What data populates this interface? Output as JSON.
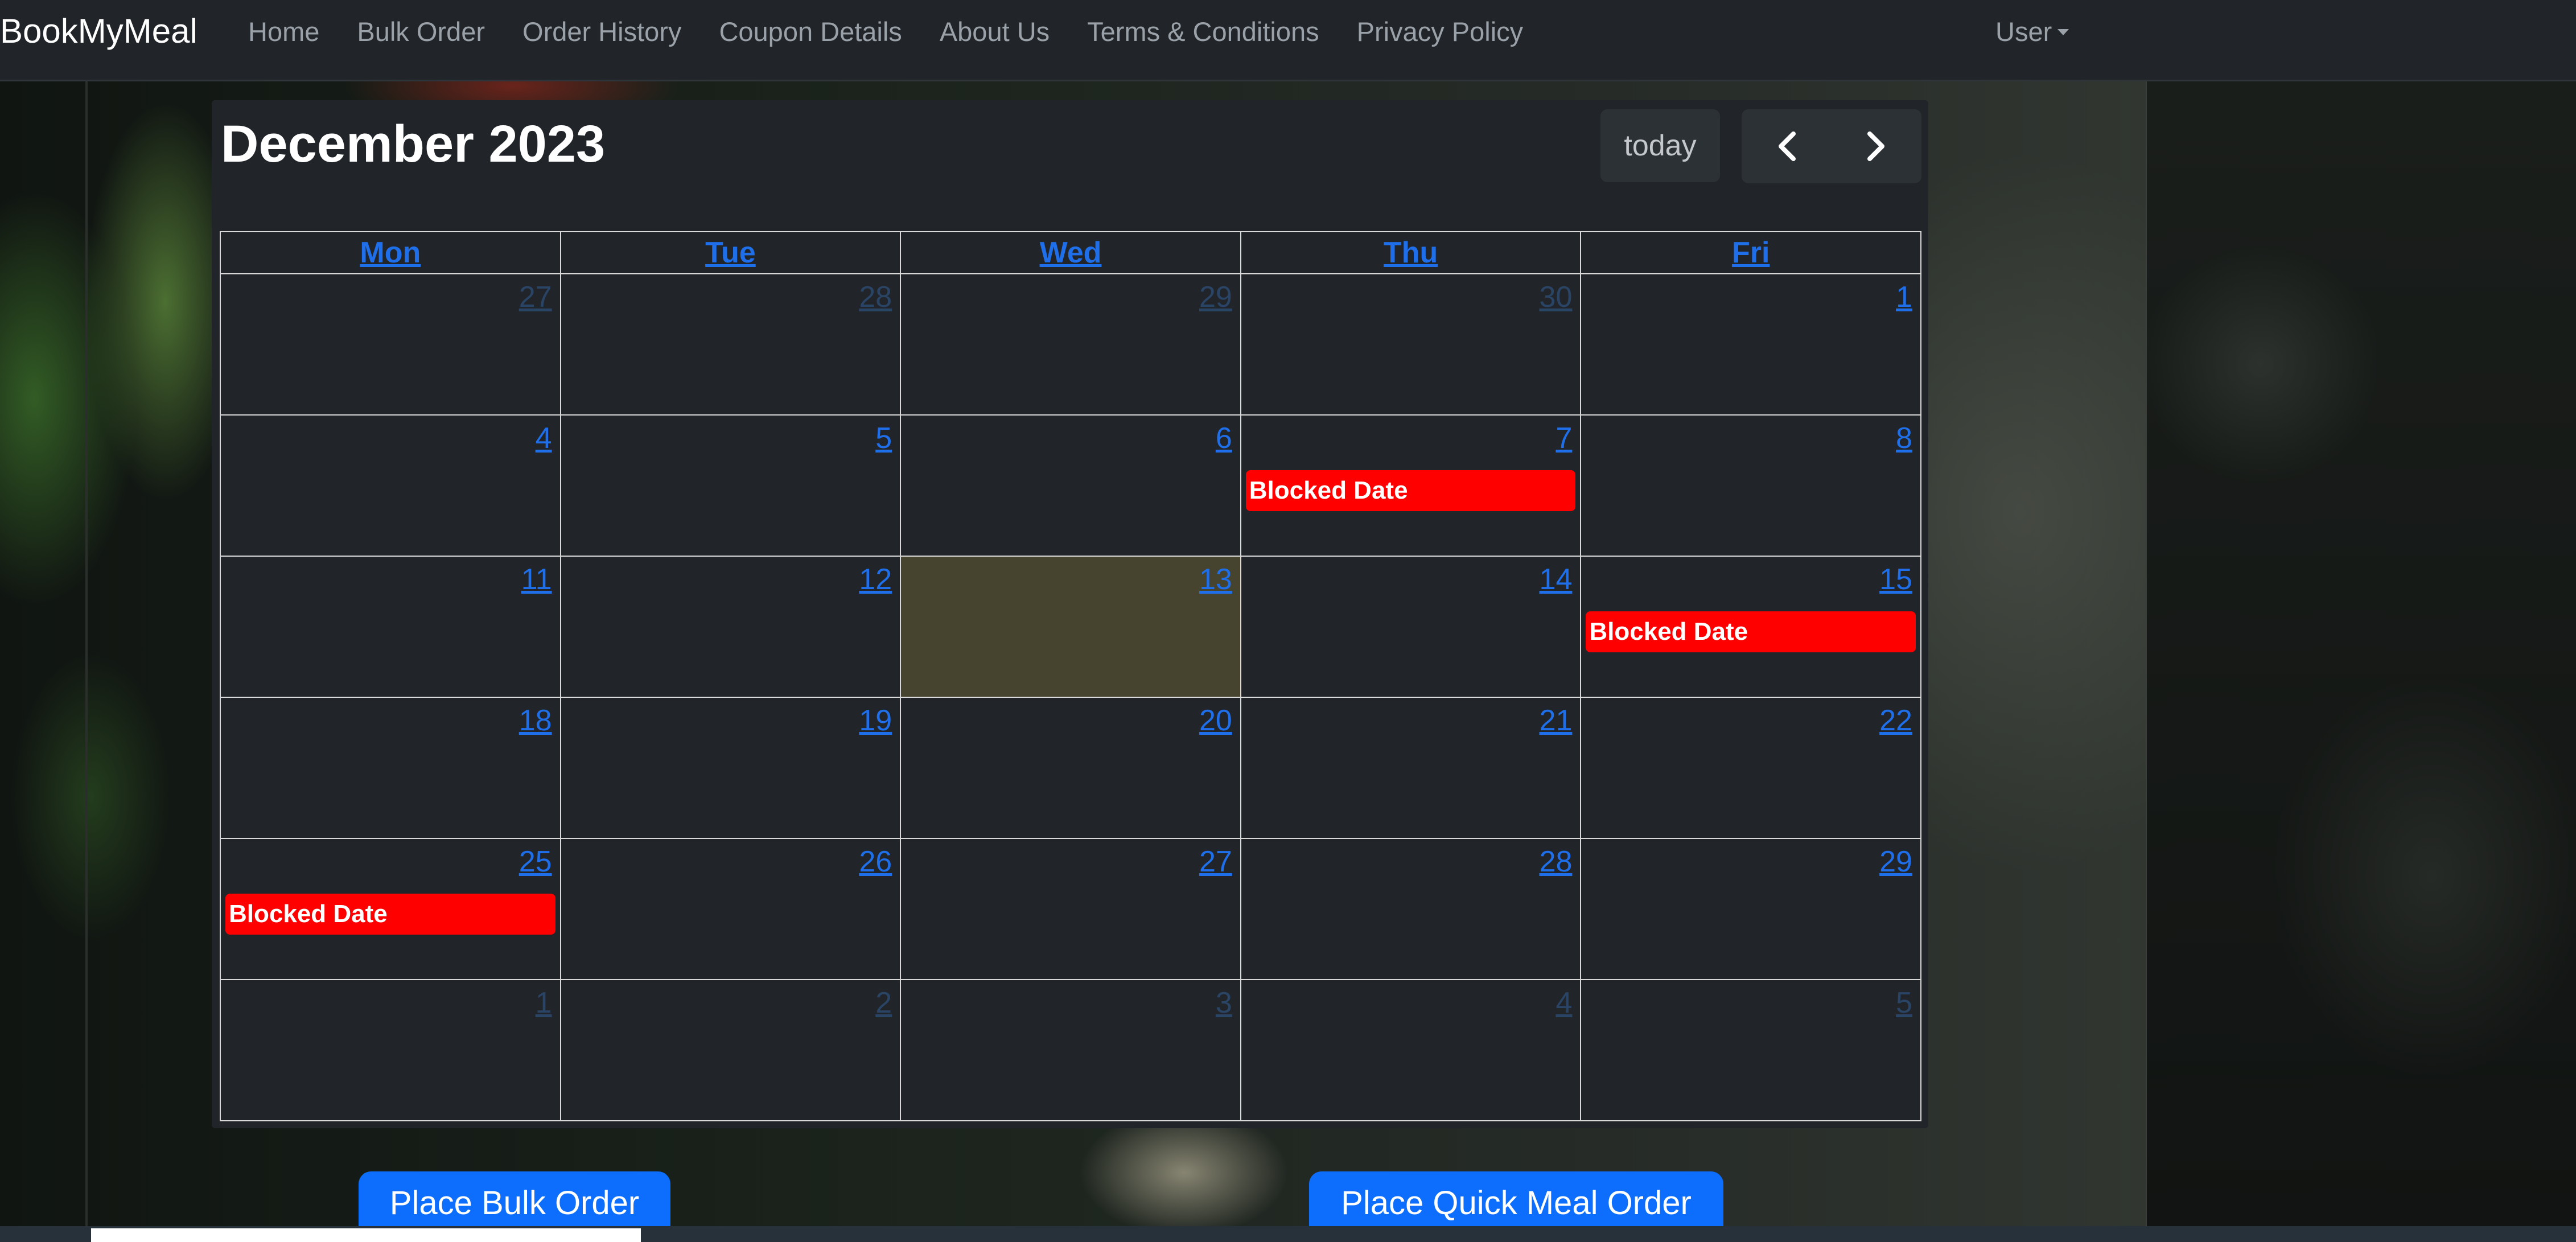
{
  "navbar": {
    "brand": "BookMyMeal",
    "links": [
      "Home",
      "Bulk Order",
      "Order History",
      "Coupon Details",
      "About Us",
      "Terms & Conditions",
      "Privacy Policy"
    ],
    "user_label": "User"
  },
  "calendar": {
    "title": "December 2023",
    "today_label": "today",
    "weekdays": [
      "Mon",
      "Tue",
      "Wed",
      "Thu",
      "Fri"
    ],
    "weeks": [
      [
        {
          "day": "27",
          "other": true
        },
        {
          "day": "28",
          "other": true
        },
        {
          "day": "29",
          "other": true
        },
        {
          "day": "30",
          "other": true
        },
        {
          "day": "1"
        }
      ],
      [
        {
          "day": "4"
        },
        {
          "day": "5"
        },
        {
          "day": "6"
        },
        {
          "day": "7",
          "event": "Blocked Date"
        },
        {
          "day": "8"
        }
      ],
      [
        {
          "day": "11"
        },
        {
          "day": "12"
        },
        {
          "day": "13",
          "today": true
        },
        {
          "day": "14"
        },
        {
          "day": "15",
          "event": "Blocked Date"
        }
      ],
      [
        {
          "day": "18"
        },
        {
          "day": "19"
        },
        {
          "day": "20"
        },
        {
          "day": "21"
        },
        {
          "day": "22"
        }
      ],
      [
        {
          "day": "25",
          "event": "Blocked Date"
        },
        {
          "day": "26"
        },
        {
          "day": "27"
        },
        {
          "day": "28"
        },
        {
          "day": "29"
        }
      ],
      [
        {
          "day": "1",
          "other": true
        },
        {
          "day": "2",
          "other": true
        },
        {
          "day": "3",
          "other": true
        },
        {
          "day": "4",
          "other": true
        },
        {
          "day": "5",
          "other": true
        }
      ]
    ]
  },
  "actions": {
    "bulk_order_label": "Place Bulk Order",
    "quick_order_label": "Place Quick Meal Order"
  },
  "icons": {
    "prev": "chevron-left-icon",
    "next": "chevron-right-icon",
    "user_caret": "caret-down-icon"
  },
  "colors": {
    "navbar_bg": "#212529",
    "calendar_bg": "#212529",
    "link_blue": "#1f6feb",
    "blocked_event": "#ff0000",
    "today_highlight": "#46432e",
    "primary_button": "#0d6efd"
  }
}
